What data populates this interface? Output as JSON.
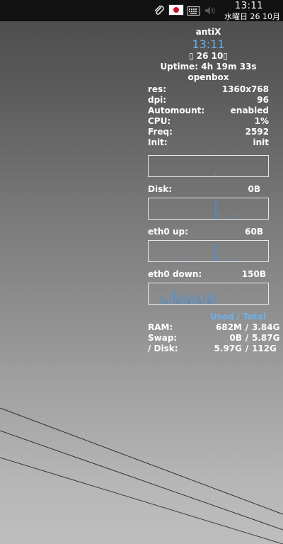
{
  "taskbar": {
    "time": "13:11",
    "date": "水曜日 26 10月",
    "icons": [
      "paperclip-icon",
      "japan-flag-icon",
      "keyboard-icon",
      "volume-icon"
    ]
  },
  "conky": {
    "hostname": "antiX",
    "time": "13:11",
    "date": "26 10",
    "date_glyph": "▯",
    "uptime": "Uptime: 4h 19m 33s",
    "wm": "openbox",
    "stats": [
      {
        "label": "res:",
        "value": "1360x768"
      },
      {
        "label": "dpi:",
        "value": "96"
      },
      {
        "label": "Automount:",
        "value": "enabled"
      },
      {
        "label": "CPU:",
        "value": "1%"
      },
      {
        "label": "Freq:",
        "value": "2592"
      },
      {
        "label": "Init:",
        "value": "init"
      }
    ],
    "disk": {
      "label": "Disk:",
      "value": "0B"
    },
    "eth_up": {
      "label": "eth0 up:",
      "value": "60B"
    },
    "eth_down": {
      "label": "eth0 down:",
      "value": "150B"
    },
    "used_total_header": "Used / Total",
    "memory": [
      {
        "label": "RAM:",
        "used": "682M",
        "sep": "/",
        "total": "3.84G"
      },
      {
        "label": "Swap:",
        "used": "0B",
        "sep": "/",
        "total": "5.87G"
      },
      {
        "label": "/ Disk:",
        "used": "5.97G",
        "sep": "/",
        "total": "112G"
      }
    ],
    "colors": {
      "accent": "#6cb0e8",
      "text": "#ffffff",
      "graph": "#4a90d9"
    }
  }
}
